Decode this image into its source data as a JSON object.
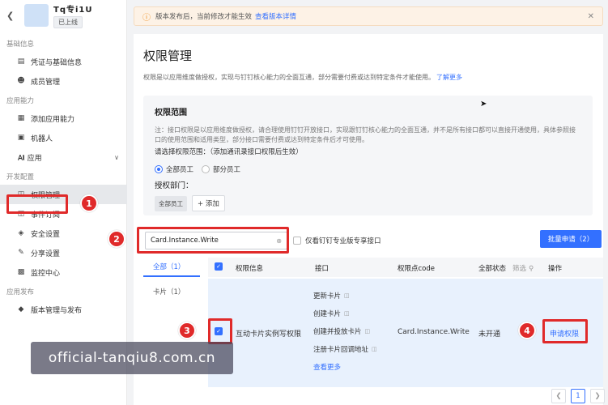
{
  "app": {
    "name": "Tq专i1U",
    "status": "已上线"
  },
  "sidebar": {
    "groups": [
      {
        "label": "基础信息",
        "items": [
          {
            "label": "凭证与基础信息",
            "icon": "credential-icon"
          },
          {
            "label": "成员管理",
            "icon": "member-icon"
          }
        ]
      },
      {
        "label": "应用能力",
        "items": [
          {
            "label": "添加应用能力",
            "icon": "grid-icon"
          },
          {
            "label": "机器人",
            "icon": "robot-icon"
          },
          {
            "label": "AI 应用",
            "icon": "ai-icon"
          }
        ]
      },
      {
        "label": "开发配置",
        "items": [
          {
            "label": "权限管理",
            "icon": "permission-icon"
          },
          {
            "label": "事件订阅",
            "icon": "event-icon"
          },
          {
            "label": "安全设置",
            "icon": "shield-icon"
          },
          {
            "label": "分享设置",
            "icon": "share-icon"
          },
          {
            "label": "监控中心",
            "icon": "monitor-icon"
          }
        ]
      },
      {
        "label": "应用发布",
        "items": [
          {
            "label": "版本管理与发布",
            "icon": "version-icon"
          }
        ]
      }
    ]
  },
  "banner": {
    "text": "版本发布后，当前修改才能生效",
    "link": "查看版本详情"
  },
  "page": {
    "title": "权限管理",
    "desc": "权限是以应用维度做授权，实现与钉钉核心能力的全面互通，部分需要付费或达到特定条件才能使用。",
    "desc_link": "了解更多"
  },
  "scope": {
    "title": "权限范围",
    "note": "注：接口权限是以应用维度做授权，请合理使用钉钉开放接口，实现跟钉钉核心能力的全面互通，并不是所有接口都可以直接开通使用，具体参照接口的使用范围和适用类型，部分接口需要付费或达到特定条件后才可使用。",
    "prompt": "请选择权限范围：（添加通讯录接口权限后生效）",
    "option_all": "全部员工",
    "option_part": "部分员工",
    "dept_label": "授权部门：",
    "dept_tag": "全部员工",
    "add_label": "+ 添加"
  },
  "toolbar": {
    "search_value": "Card.Instance.Write",
    "only_pro_label": "仅看钉钉专业版专享接口",
    "batch_label": "批量申请（2）"
  },
  "categories": {
    "all": "全部（1）",
    "card": "卡片（1）"
  },
  "table": {
    "headers": {
      "info": "权限信息",
      "api": "接口",
      "code": "权限点code",
      "status": "全部状态",
      "filter": "筛选",
      "action": "操作"
    },
    "row": {
      "info": "互动卡片实例写权限",
      "apis": [
        "更新卡片",
        "创建卡片",
        "创建并投放卡片",
        "注册卡片回调地址"
      ],
      "more": "查看更多",
      "code": "Card.Instance.Write",
      "status": "未开通",
      "action": "申请权限"
    }
  },
  "pager": {
    "current": "1"
  },
  "annotations": [
    "1",
    "2",
    "3",
    "4"
  ],
  "watermark": "official-tanqiu8.com.cn"
}
